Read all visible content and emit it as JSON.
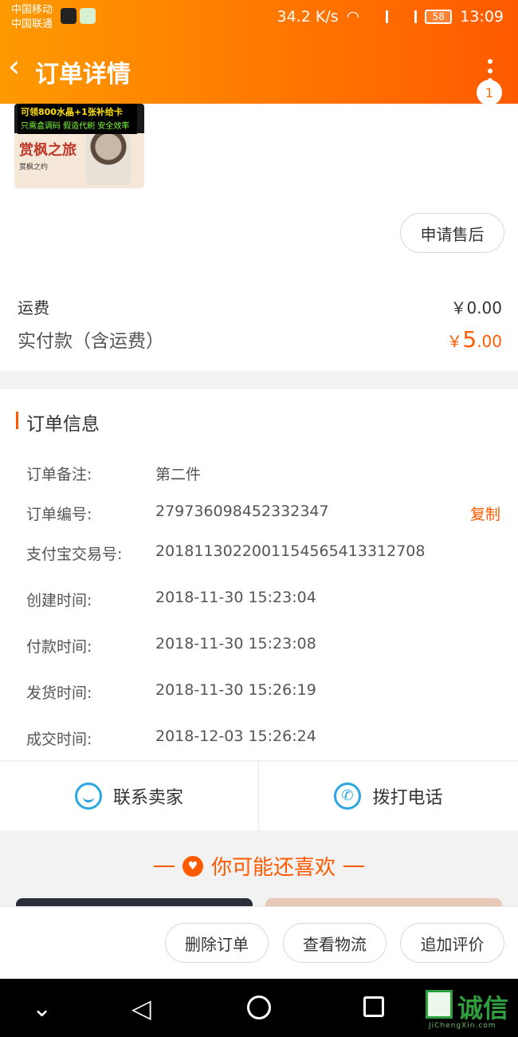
{
  "status_bar": {
    "carrier1": "中国移动",
    "carrier2": "中国联通",
    "speed": "34.2 K/s",
    "net1": "2G",
    "net2": "4G",
    "battery": "58",
    "time": "13:09"
  },
  "header": {
    "title": "订单详情",
    "badge_count": "1"
  },
  "product": {
    "banner_line1": "可领800水晶+1张补给卡",
    "banner_line2": "只需盒调码 假造代刷 安全效率",
    "game_title": "赏枫之旅",
    "small_text": "赏枫之约",
    "after_sale": "申请售后"
  },
  "fees": {
    "shipping_label": "运费",
    "shipping_value": "￥0.00",
    "paid_label": "实付款（含运费）",
    "paid_currency": "￥",
    "paid_int": "5",
    "paid_dec": ".00"
  },
  "order_info": {
    "title": "订单信息",
    "copy_label": "复制",
    "rows": [
      {
        "label": "订单备注:",
        "value": "第二件"
      },
      {
        "label": "订单编号:",
        "value": "279736098452332347"
      },
      {
        "label": "支付宝交易号:",
        "value": "2018113022001154565413312708"
      },
      {
        "label": "创建时间:",
        "value": "2018-11-30 15:23:04"
      },
      {
        "label": "付款时间:",
        "value": "2018-11-30 15:23:08"
      },
      {
        "label": "发货时间:",
        "value": "2018-11-30 15:26:19"
      },
      {
        "label": "成交时间:",
        "value": "2018-12-03 15:26:24"
      }
    ]
  },
  "contact": {
    "seller": "联系卖家",
    "call": "拨打电话"
  },
  "recommend": {
    "title": "你可能还喜欢"
  },
  "actions": {
    "delete": "删除订单",
    "logistics": "查看物流",
    "review": "追加评价"
  },
  "watermark": {
    "text": "诚信",
    "sub": "JiChengXin.com"
  }
}
